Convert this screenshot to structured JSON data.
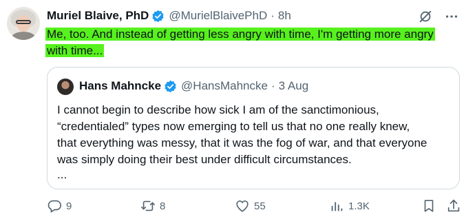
{
  "author": {
    "name": "Muriel Blaive, PhD",
    "handle": "@MurielBlaivePhD",
    "separator": "·",
    "time": "8h"
  },
  "tweet": {
    "line1": "Me, too. And instead of getting less angry with time, I'm getting more angry",
    "line2": "with time..."
  },
  "quote": {
    "name": "Hans Mahncke",
    "handle": "@HansMahncke",
    "separator": "·",
    "date": "3 Aug",
    "lines": [
      "I cannot begin to describe how sick I am of the sanctimonious,",
      "“credentialed” types now emerging to tell us that no one really knew,",
      "that everything was messy, that it was the fog of war, and that everyone",
      "was simply doing their best under difficult circumstances."
    ],
    "more": "..."
  },
  "actions": {
    "replies": "9",
    "retweets": "8",
    "likes": "55",
    "views": "1.3K"
  },
  "icons": {
    "verified": "verified-badge-icon",
    "grok": "grok-icon",
    "more": "more-dots-icon",
    "reply": "reply-icon",
    "retweet": "retweet-icon",
    "like": "heart-icon",
    "views": "views-icon",
    "bookmark": "bookmark-icon",
    "share": "share-icon"
  },
  "colors": {
    "highlight": "#57f11e",
    "verified": "#1d9bf0",
    "secondary_text": "#536471",
    "border": "#cfd9de"
  }
}
